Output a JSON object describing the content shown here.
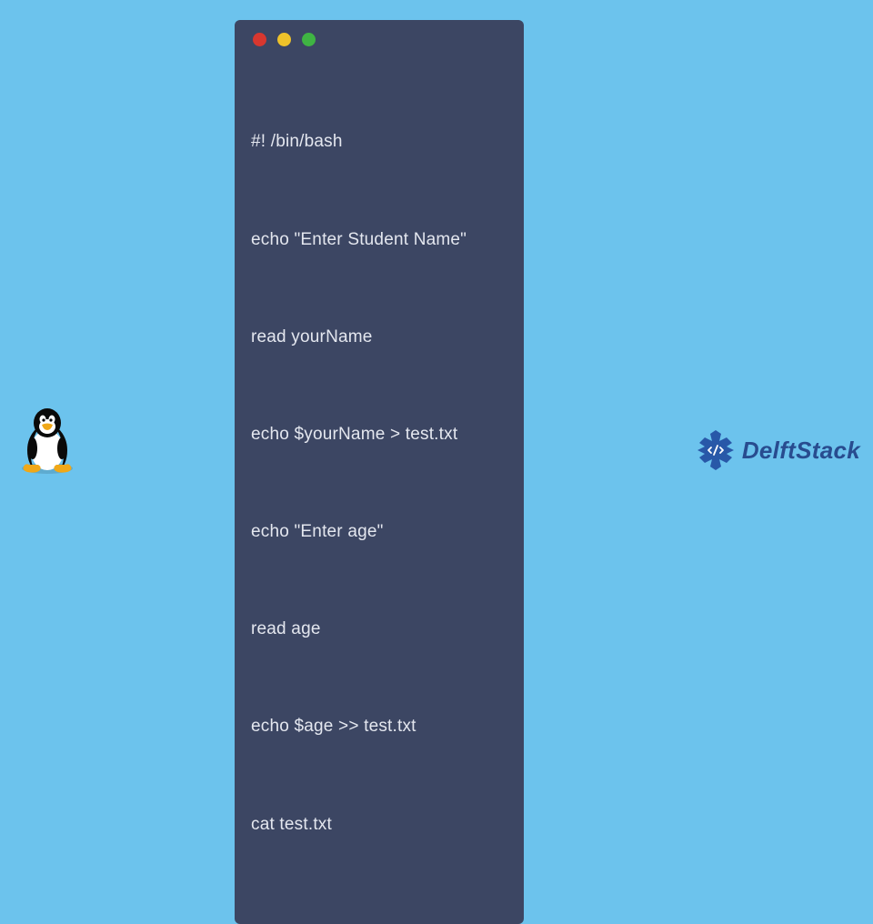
{
  "window": {
    "dots": [
      "red",
      "yellow",
      "green"
    ]
  },
  "code": {
    "lines": [
      "#! /bin/bash",
      "echo \"Enter Student Name\"",
      "read yourName",
      "echo $yourName > test.txt",
      "echo \"Enter age\"",
      "read age",
      "echo $age >> test.txt",
      "cat test.txt"
    ]
  },
  "branding": {
    "site_name": "DelftStack"
  }
}
